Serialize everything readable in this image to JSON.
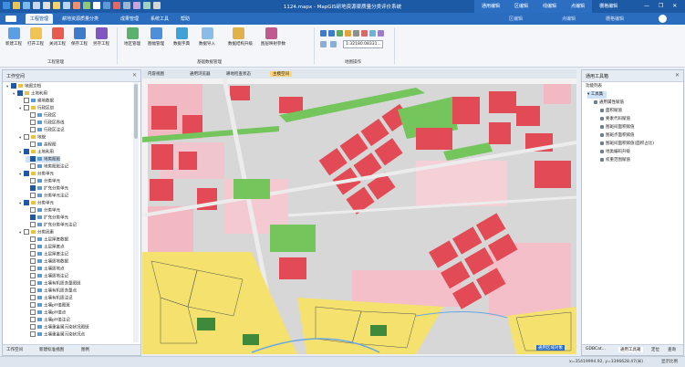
{
  "app": {
    "title": "1124.mapx - MapGIS研地资源渠质量分类评价系统",
    "right_tabs": [
      "通用编辑",
      "区编辑",
      "线编辑",
      "点编辑",
      "栅格编辑"
    ],
    "window_controls": "— ❐ ✕"
  },
  "menu": {
    "items": [
      "工程管理",
      "耕地资源质量分类",
      "成果管理",
      "系统工具",
      "帮助"
    ],
    "active": "工程管理",
    "right_items": [
      "区编辑",
      "点编辑",
      "栅格编辑"
    ]
  },
  "ribbon": {
    "project_buttons": [
      "新建工程",
      "打开工程",
      "关闭工程",
      "保存工程",
      "另存工程"
    ],
    "base_buttons": [
      "地区管理",
      "图幅管理",
      "数据字典",
      "数据导入",
      "数据结构升级",
      "图层映射参数"
    ],
    "groups": [
      "工程管理",
      "基础数据管理",
      "地图操作"
    ],
    "scale_value": "1:32180.08331..."
  },
  "left_panel": {
    "title": "工作空间",
    "pin": "✕",
    "tree": [
      {
        "label": "地图文档",
        "indent": 0,
        "checked": true,
        "folder": true,
        "expand": "▾"
      },
      {
        "label": "土地利用",
        "indent": 1,
        "checked": true,
        "folder": true,
        "expand": "▾"
      },
      {
        "label": "耕地数据",
        "indent": 2,
        "checked": false,
        "folder": false,
        "expand": ""
      },
      {
        "label": "行政区划",
        "indent": 2,
        "checked": false,
        "folder": true,
        "expand": "▾"
      },
      {
        "label": "行政区",
        "indent": 3,
        "checked": false,
        "folder": false,
        "expand": ""
      },
      {
        "label": "行政区界线",
        "indent": 3,
        "checked": false,
        "folder": false,
        "expand": ""
      },
      {
        "label": "行政区注记",
        "indent": 3,
        "checked": false,
        "folder": false,
        "expand": ""
      },
      {
        "label": "地貌",
        "indent": 2,
        "checked": false,
        "folder": true,
        "expand": "▾"
      },
      {
        "label": "高程图",
        "indent": 3,
        "checked": false,
        "folder": false,
        "expand": ""
      },
      {
        "label": "土地利用",
        "indent": 2,
        "checked": true,
        "folder": true,
        "expand": "▾"
      },
      {
        "label": "地类图斑",
        "indent": 3,
        "checked": true,
        "folder": false,
        "expand": "",
        "selected": true
      },
      {
        "label": "地类图斑注记",
        "indent": 3,
        "checked": false,
        "folder": false,
        "expand": ""
      },
      {
        "label": "分类单元",
        "indent": 2,
        "checked": true,
        "folder": true,
        "expand": "▾"
      },
      {
        "label": "分类单元",
        "indent": 3,
        "checked": false,
        "folder": false,
        "expand": ""
      },
      {
        "label": "扩充分类单元",
        "indent": 3,
        "checked": true,
        "folder": false,
        "expand": ""
      },
      {
        "label": "分类单元注记",
        "indent": 3,
        "checked": false,
        "folder": false,
        "expand": ""
      },
      {
        "label": "分类单元",
        "indent": 2,
        "checked": true,
        "folder": true,
        "expand": "▾"
      },
      {
        "label": "分类单元",
        "indent": 3,
        "checked": false,
        "folder": false,
        "expand": ""
      },
      {
        "label": "扩充分类单元",
        "indent": 3,
        "checked": true,
        "folder": false,
        "expand": ""
      },
      {
        "label": "扩充分类单元注记",
        "indent": 3,
        "checked": false,
        "folder": false,
        "expand": ""
      },
      {
        "label": "分类因素",
        "indent": 2,
        "checked": false,
        "folder": true,
        "expand": "▾"
      },
      {
        "label": "土层厚度数据",
        "indent": 3,
        "checked": false,
        "folder": false,
        "expand": ""
      },
      {
        "label": "土层厚度点",
        "indent": 3,
        "checked": false,
        "folder": false,
        "expand": ""
      },
      {
        "label": "土层厚度注记",
        "indent": 3,
        "checked": false,
        "folder": false,
        "expand": ""
      },
      {
        "label": "土壤质地数据",
        "indent": 3,
        "checked": false,
        "folder": false,
        "expand": ""
      },
      {
        "label": "土壤质地点",
        "indent": 3,
        "checked": false,
        "folder": false,
        "expand": ""
      },
      {
        "label": "土壤质地注记",
        "indent": 3,
        "checked": false,
        "folder": false,
        "expand": ""
      },
      {
        "label": "土壤有机质含量图斑",
        "indent": 3,
        "checked": false,
        "folder": false,
        "expand": ""
      },
      {
        "label": "土壤有机质含量点",
        "indent": 3,
        "checked": false,
        "folder": false,
        "expand": ""
      },
      {
        "label": "土壤有机质注记",
        "indent": 3,
        "checked": false,
        "folder": false,
        "expand": ""
      },
      {
        "label": "土壤pH值图斑",
        "indent": 3,
        "checked": false,
        "folder": false,
        "expand": ""
      },
      {
        "label": "土壤pH值点",
        "indent": 3,
        "checked": false,
        "folder": false,
        "expand": ""
      },
      {
        "label": "土壤pH值注记",
        "indent": 3,
        "checked": false,
        "folder": false,
        "expand": ""
      },
      {
        "label": "土壤重金属污染状况图斑",
        "indent": 3,
        "checked": false,
        "folder": false,
        "expand": ""
      },
      {
        "label": "土壤重金属污染状况点",
        "indent": 3,
        "checked": false,
        "folder": false,
        "expand": ""
      }
    ],
    "tabs": [
      "工作空间",
      "新建标准视图",
      "图例"
    ]
  },
  "doc_tabs": [
    "内容视图",
    "通用浏览器",
    "耕地检查状态",
    "主模空间"
  ],
  "doc_tab_active": "主模空间",
  "map": {
    "badge": "通用区域对象"
  },
  "right_panel": {
    "title": "通用工具箱",
    "pin": "✕",
    "section": "功能列表",
    "root": "工具集",
    "tools": [
      {
        "label": "通用属性赋值",
        "indent": 1
      },
      {
        "label": "面积赋值",
        "indent": 2
      },
      {
        "label": "要素代码赋值",
        "indent": 2
      },
      {
        "label": "图斑间面积赋值",
        "indent": 2
      },
      {
        "label": "图斑点面积赋值",
        "indent": 2
      },
      {
        "label": "图斑间面积赋值(面积占比)",
        "indent": 2
      },
      {
        "label": "地类编码升级",
        "indent": 2
      },
      {
        "label": "权重范围赋值",
        "indent": 2
      }
    ],
    "tabs": [
      "GDBCat...",
      "通用工具箱",
      "定位",
      "查询"
    ],
    "active_tab": "通用工具箱"
  },
  "status": {
    "coords": "x=35419994.92, y=3396628.47(米)",
    "display": "显示比例"
  },
  "colors": {
    "title_bar": "#1c5aa6",
    "menu_bar": "#2a6cbe",
    "map_red": "#e24b56",
    "map_pink": "#f4b8c2",
    "map_green": "#73c55c",
    "map_yellow": "#f5e16d",
    "map_grey": "#d3d3d3"
  }
}
